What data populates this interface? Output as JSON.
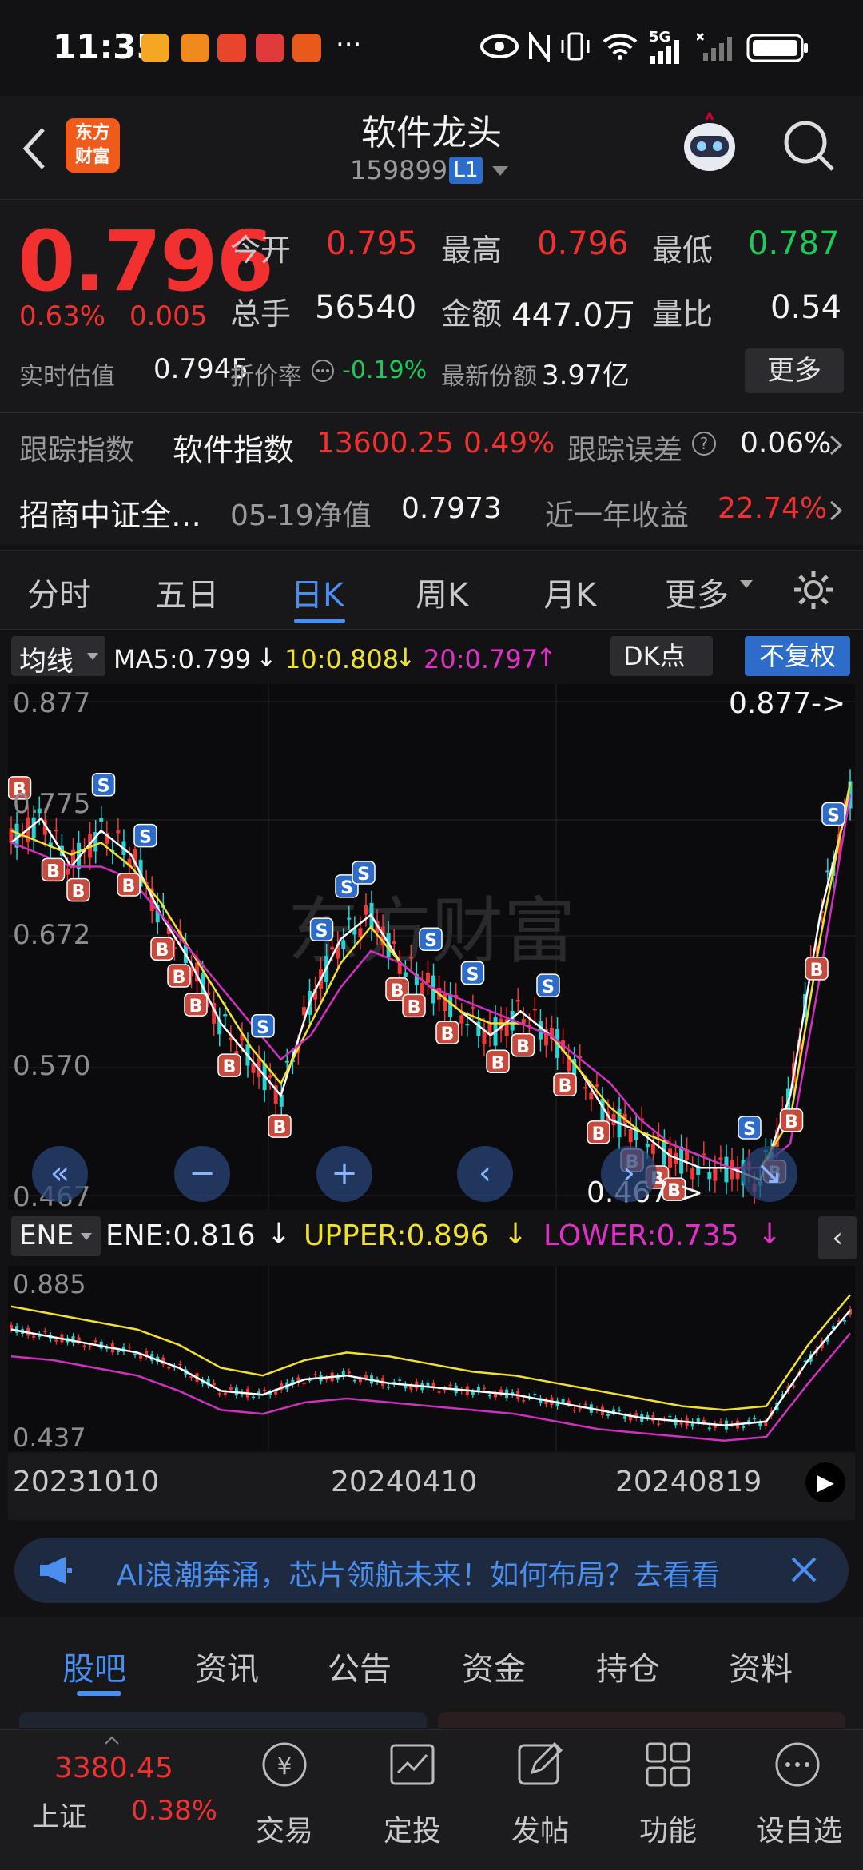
{
  "status": {
    "time": "11:35",
    "network": "5G",
    "dots": "···"
  },
  "header": {
    "title": "软件龙头",
    "code": "159899",
    "badge": "L1"
  },
  "quote": {
    "price": "0.796",
    "pct": "0.63%",
    "chg": "0.005",
    "open_label": "今开",
    "open": "0.795",
    "high_label": "最高",
    "high": "0.796",
    "low_label": "最低",
    "low": "0.787",
    "vol_label": "总手",
    "vol": "56540",
    "amt_label": "金额",
    "amt": "447.0万",
    "ratio_label": "量比",
    "ratio": "0.54",
    "est_label": "实时估值",
    "est": "0.7945",
    "disc_label": "折价率",
    "disc": "-0.19%",
    "share_label": "最新份额",
    "share": "3.97亿",
    "more": "更多"
  },
  "tracking": {
    "label": "跟踪指数",
    "index": "软件指数",
    "index_val": "13600.25",
    "index_pct": "0.49%",
    "err_label": "跟踪误差",
    "err": "0.06%"
  },
  "fund": {
    "name": "招商中证全…",
    "nav_label": "05-19净值",
    "nav": "0.7973",
    "ret_label": "近一年收益",
    "ret": "22.74%"
  },
  "tabs": [
    "分时",
    "五日",
    "日K",
    "周K",
    "月K",
    "更多"
  ],
  "ma": {
    "selector": "均线",
    "ma5": "MA5:0.799",
    "ma10": "10:0.808",
    "ma20": "20:0.797",
    "dk": "DK点",
    "fq": "不复权"
  },
  "kchart": {
    "y_top": "0.877",
    "y_2": "0.775",
    "y_3": "0.672",
    "y_4": "0.570",
    "y_bot": "0.467",
    "max_label": "0.877->",
    "min_label": "0.467->"
  },
  "ene": {
    "selector": "ENE",
    "ene": "ENE:0.816",
    "upper": "UPPER:0.896",
    "lower": "LOWER:0.735",
    "y_top": "0.885",
    "y_bot": "0.437"
  },
  "dates": [
    "20231010",
    "20240410",
    "20240819"
  ],
  "banner": {
    "text": "AI浪潮奔涌，芯片领航未来！如何布局？去看看"
  },
  "bottom_tabs": [
    "股吧",
    "资讯",
    "公告",
    "资金",
    "持仓",
    "资料"
  ],
  "nav": {
    "index_val": "3380.45",
    "index_name": "上证",
    "index_pct": "0.38%",
    "items": [
      "交易",
      "定投",
      "发帖",
      "功能",
      "设自选"
    ]
  },
  "chart_data": [
    {
      "type": "line",
      "name": "daily-k",
      "series": [
        {
          "name": "MA5",
          "values": [
            0.76,
            0.78,
            0.74,
            0.77,
            0.75,
            0.7,
            0.66,
            0.61,
            0.58,
            0.55,
            0.63,
            0.68,
            0.7,
            0.66,
            0.64,
            0.62,
            0.6,
            0.62,
            0.6,
            0.57,
            0.53,
            0.52,
            0.5,
            0.49,
            0.49,
            0.48,
            0.55,
            0.7,
            0.8
          ]
        },
        {
          "name": "10",
          "values": [
            0.77,
            0.76,
            0.75,
            0.76,
            0.74,
            0.71,
            0.67,
            0.63,
            0.59,
            0.56,
            0.61,
            0.66,
            0.69,
            0.66,
            0.64,
            0.62,
            0.61,
            0.61,
            0.6,
            0.57,
            0.54,
            0.52,
            0.51,
            0.5,
            0.49,
            0.49,
            0.53,
            0.68,
            0.81
          ]
        },
        {
          "name": "20",
          "values": [
            0.76,
            0.75,
            0.74,
            0.74,
            0.73,
            0.7,
            0.67,
            0.64,
            0.61,
            0.58,
            0.6,
            0.64,
            0.67,
            0.66,
            0.64,
            0.63,
            0.62,
            0.61,
            0.6,
            0.58,
            0.56,
            0.53,
            0.51,
            0.5,
            0.49,
            0.49,
            0.51,
            0.65,
            0.8
          ]
        }
      ]
    },
    {
      "type": "line",
      "name": "ENE",
      "series": [
        {
          "name": "UPPER",
          "values": [
            0.8,
            0.78,
            0.76,
            0.74,
            0.7,
            0.64,
            0.62,
            0.66,
            0.68,
            0.67,
            0.65,
            0.63,
            0.62,
            0.6,
            0.58,
            0.56,
            0.54,
            0.53,
            0.54,
            0.7,
            0.83
          ]
        },
        {
          "name": "ENE",
          "values": [
            0.74,
            0.72,
            0.7,
            0.68,
            0.64,
            0.58,
            0.57,
            0.61,
            0.62,
            0.6,
            0.59,
            0.58,
            0.57,
            0.55,
            0.53,
            0.51,
            0.5,
            0.49,
            0.5,
            0.66,
            0.79
          ]
        },
        {
          "name": "LOWER",
          "values": [
            0.67,
            0.66,
            0.64,
            0.62,
            0.58,
            0.53,
            0.52,
            0.55,
            0.56,
            0.55,
            0.54,
            0.53,
            0.52,
            0.5,
            0.48,
            0.47,
            0.46,
            0.45,
            0.46,
            0.6,
            0.73
          ]
        }
      ]
    }
  ]
}
